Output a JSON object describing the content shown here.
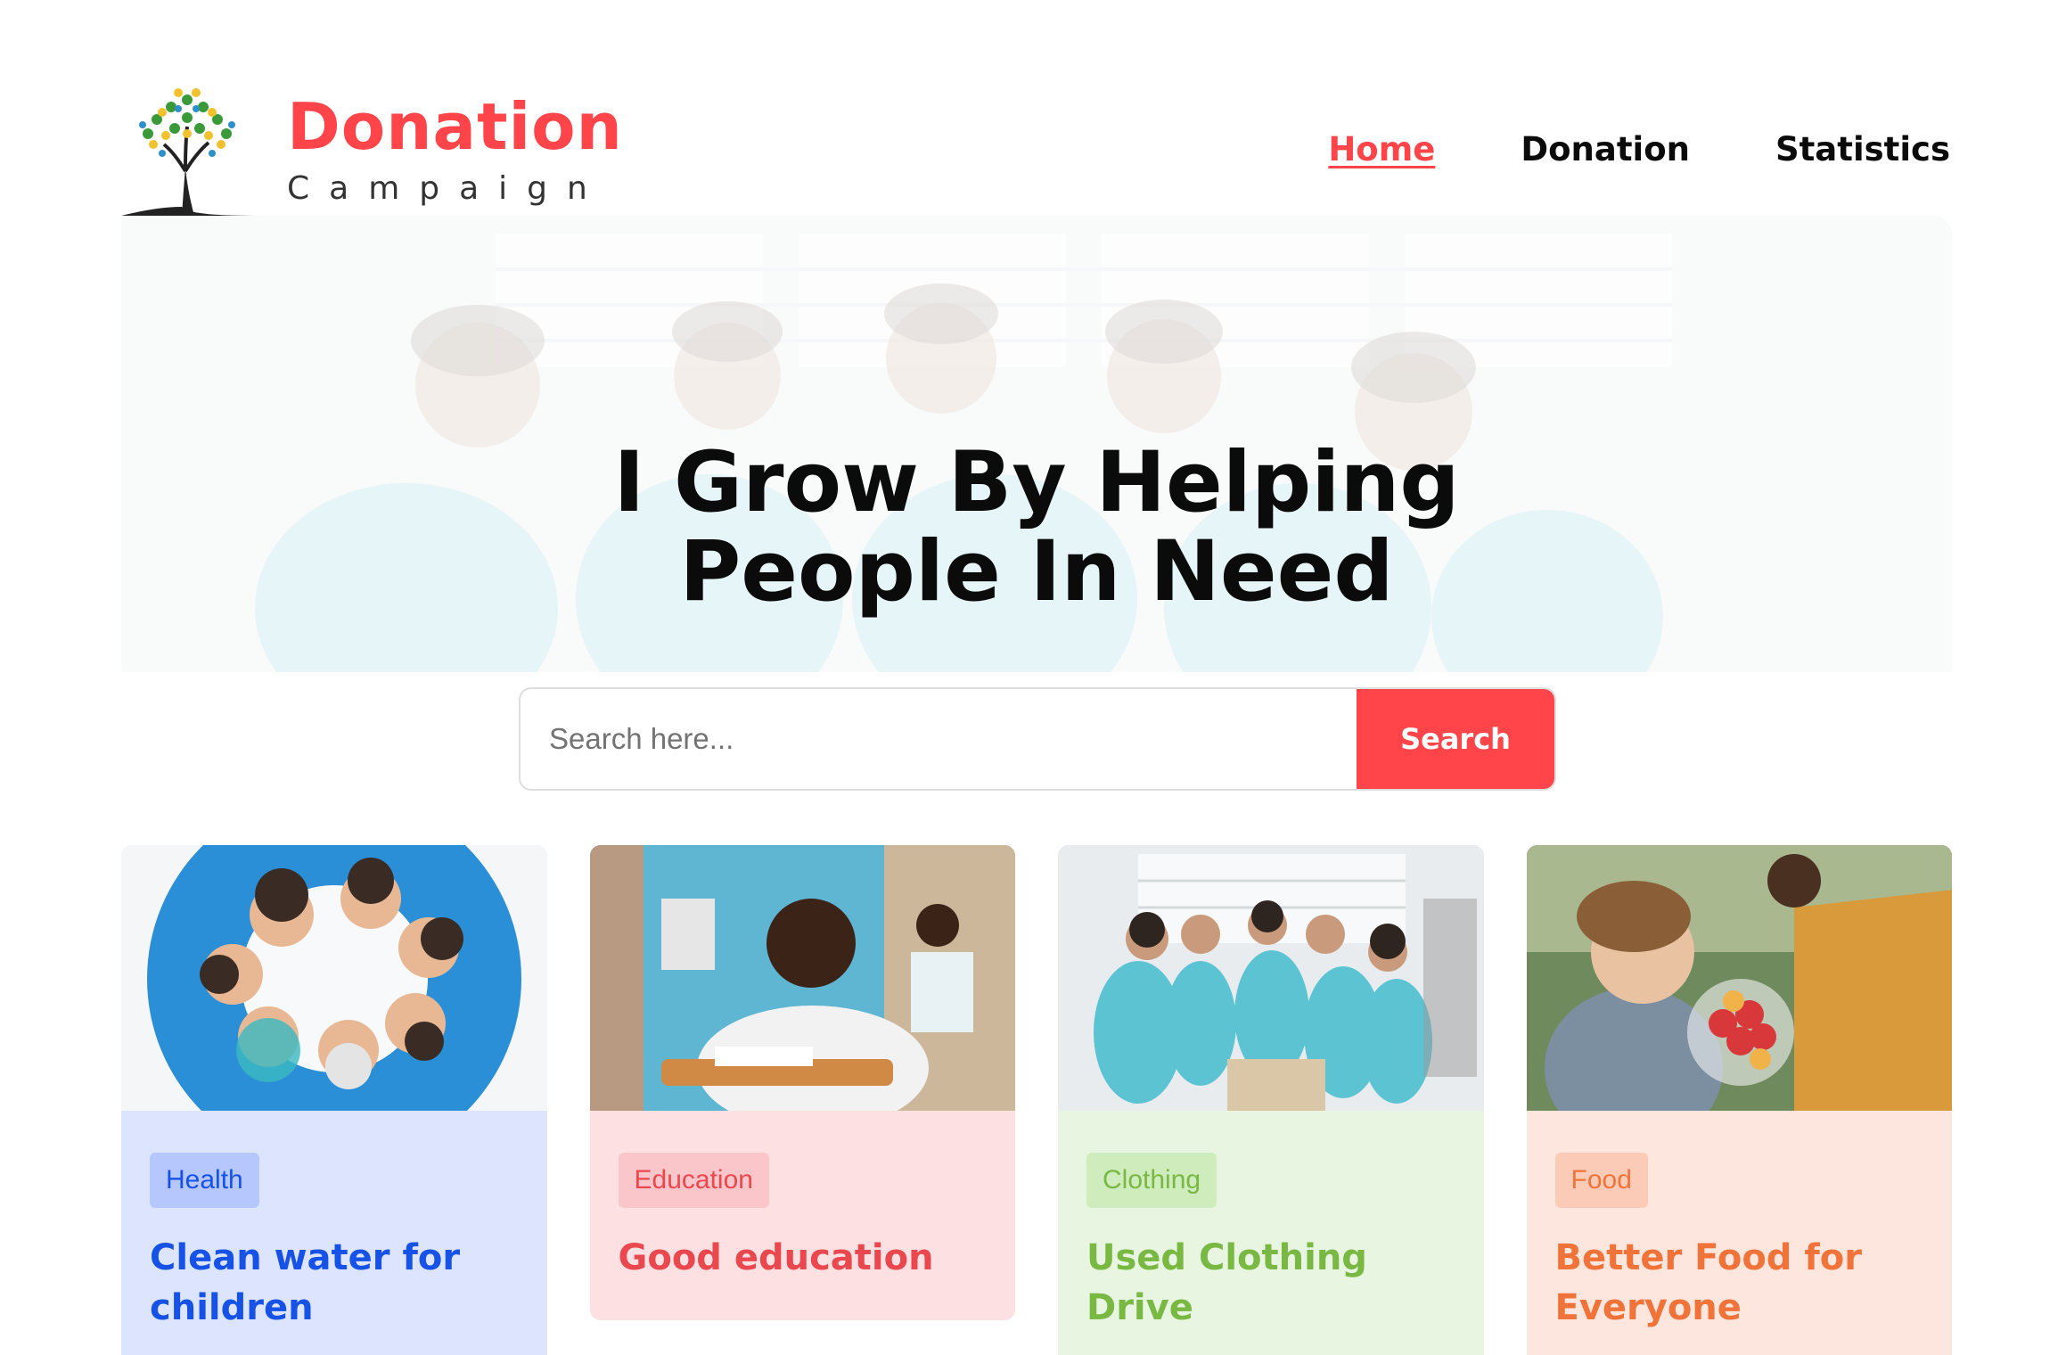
{
  "brand": {
    "title": "Donation",
    "subtitle": "Campaign"
  },
  "nav": [
    {
      "label": "Home",
      "active": true
    },
    {
      "label": "Donation",
      "active": false
    },
    {
      "label": "Statistics",
      "active": false
    }
  ],
  "banner": {
    "headline": "I Grow By Helping People In Need"
  },
  "search": {
    "placeholder": "Search here...",
    "button_label": "Search"
  },
  "cards": [
    {
      "category": "Health",
      "title": "Clean water for children",
      "card_bg": "#dce4fe",
      "badge_bg": "#b5c7fd",
      "text_color": "#1752e6",
      "icon": "volunteers-circle-image"
    },
    {
      "category": "Education",
      "title": "Good education",
      "card_bg": "#fde1e2",
      "badge_bg": "#fbc6c9",
      "text_color": "#e9484f",
      "icon": "student-classroom-image"
    },
    {
      "category": "Clothing",
      "title": "Used Clothing Drive",
      "card_bg": "#e8f5e0",
      "badge_bg": "#cfecbc",
      "text_color": "#78b843",
      "icon": "clothing-volunteers-image"
    },
    {
      "category": "Food",
      "title": "Better Food for Everyone",
      "card_bg": "#fde6de",
      "badge_bg": "#fbcbb8",
      "text_color": "#f0743a",
      "icon": "food-donation-image"
    }
  ]
}
